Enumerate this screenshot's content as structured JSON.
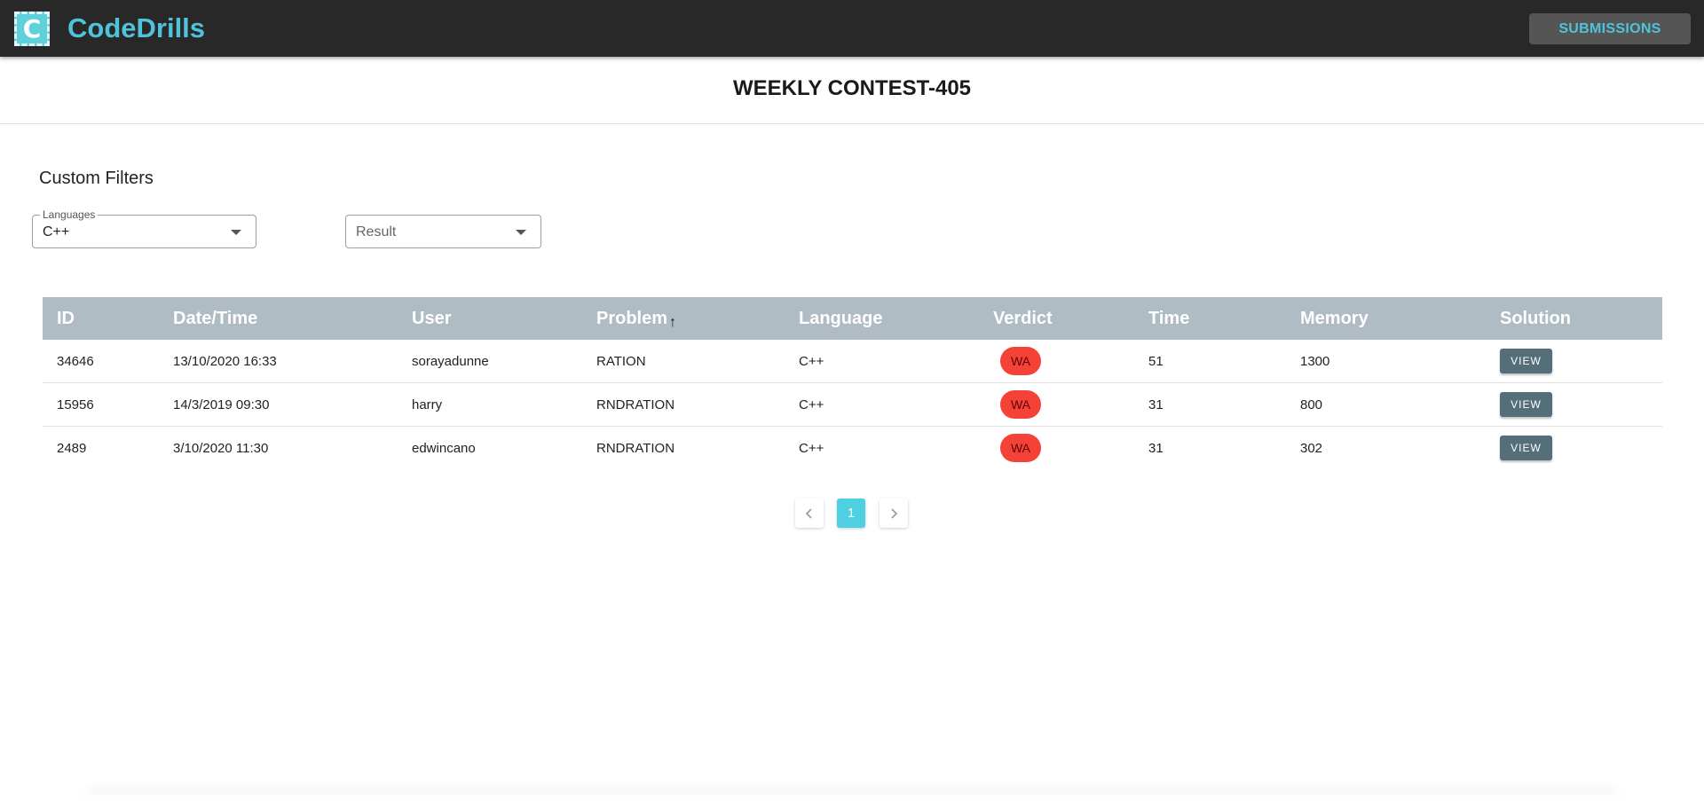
{
  "app": {
    "logo_letter": "C",
    "brand": "CodeDrills",
    "submissions_label": "SUBMISSIONS"
  },
  "contest": {
    "title": "WEEKLY CONTEST-405"
  },
  "filters": {
    "heading": "Custom Filters",
    "languages": {
      "label": "Languages",
      "value": "C++"
    },
    "result": {
      "placeholder": "Result"
    }
  },
  "table": {
    "headers": [
      "ID",
      "Date/Time",
      "User",
      "Problem",
      "Language",
      "Verdict",
      "Time",
      "Memory",
      "Solution"
    ],
    "sort_column": "Problem",
    "rows": [
      {
        "id": "34646",
        "datetime": "13/10/2020 16:33",
        "user": "sorayadunne",
        "problem": "RATION",
        "language": "C++",
        "verdict": "WA",
        "time": "51",
        "memory": "1300",
        "solution": "VIEW"
      },
      {
        "id": "15956",
        "datetime": "14/3/2019 09:30",
        "user": "harry",
        "problem": "RNDRATION",
        "language": "C++",
        "verdict": "WA",
        "time": "31",
        "memory": "800",
        "solution": "VIEW"
      },
      {
        "id": "2489",
        "datetime": "3/10/2020 11:30",
        "user": "edwincano",
        "problem": "RNDRATION",
        "language": "C++",
        "verdict": "WA",
        "time": "31",
        "memory": "302",
        "solution": "VIEW"
      }
    ]
  },
  "pagination": {
    "prev_icon": "chevron-left-icon",
    "current_page": "1",
    "next_icon": "chevron-right-icon"
  },
  "colors": {
    "appbar": "#282828",
    "brand": "#4fc3d9",
    "table_header": "#b0bcc3",
    "verdict_wa": "#f44336",
    "view_button": "#546e7a",
    "active_page": "#4fd0e2"
  }
}
